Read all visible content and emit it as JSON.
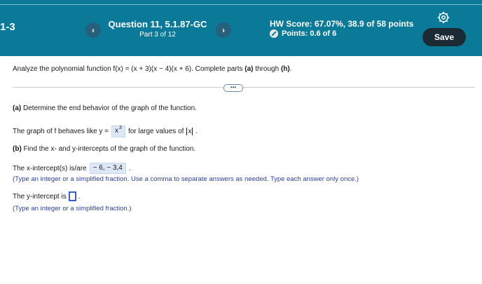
{
  "header": {
    "hw_left": "1-3",
    "question_title": "Question 11, 5.1.87-GC",
    "question_part": "Part 3 of 12",
    "prev_icon": "chevron-left-icon",
    "next_icon": "chevron-right-icon",
    "prev_label": "‹",
    "next_label": "›",
    "hw_score": "HW Score: 67.07%, 38.9 of 58 points",
    "points": "Points: 0.6 of 6",
    "settings_icon": "gear-icon",
    "save_label": "Save"
  },
  "colors": {
    "header_bg": "#0b7a99",
    "save_bg": "#1c2a33",
    "hint_text": "#2c3f9a",
    "answer_bg": "#dde7f5"
  },
  "main": {
    "instruction_pre": "Analyze the polynomial function f(x) = (x + 3)(x − 4)(x + 6). Complete parts ",
    "instruction_a": "(a)",
    "instruction_mid": " through ",
    "instruction_h": "(h)",
    "instruction_end": ".",
    "expand_label": "•••",
    "part_a_label": "(a)",
    "part_a_text": " Determine the end behavior of the graph of the function.",
    "end_behavior_pre": "The graph of f behaves like y =",
    "end_behavior_base": "x",
    "end_behavior_exp": "3",
    "end_behavior_post": "for large values of",
    "end_behavior_abs": "x",
    "end_behavior_dot": ".",
    "part_b_label": "(b)",
    "part_b_text": " Find the x- and y-intercepts of the graph of the function.",
    "xint_pre": "The x-intercept(s) is/are",
    "xint_value": "− 6, − 3,4",
    "xint_dot": ".",
    "xint_hint": "(Type an integer or a simplified fraction. Use a comma to separate answers as needed. Type each answer only once.)",
    "yint_pre": "The y-intercept is",
    "yint_value": "",
    "yint_dot": ".",
    "yint_hint": "(Type an integer or a simplified fraction.)"
  }
}
